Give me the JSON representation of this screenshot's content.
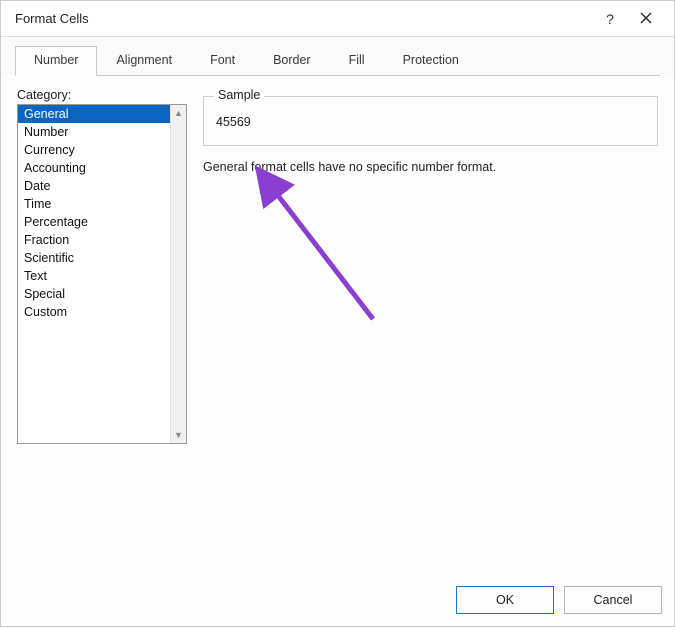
{
  "title_bar": {
    "title": "Format Cells"
  },
  "tabs": {
    "items": [
      {
        "label": "Number"
      },
      {
        "label": "Alignment"
      },
      {
        "label": "Font"
      },
      {
        "label": "Border"
      },
      {
        "label": "Fill"
      },
      {
        "label": "Protection"
      }
    ],
    "active_index": 0
  },
  "category": {
    "label": "Category:",
    "items": [
      "General",
      "Number",
      "Currency",
      "Accounting",
      "Date",
      "Time",
      "Percentage",
      "Fraction",
      "Scientific",
      "Text",
      "Special",
      "Custom"
    ],
    "selected_index": 0
  },
  "sample": {
    "legend": "Sample",
    "value": "45569"
  },
  "description": "General format cells have no specific number format.",
  "footer": {
    "ok": "OK",
    "cancel": "Cancel"
  },
  "annotation": {
    "color": "#8a3fd0"
  }
}
